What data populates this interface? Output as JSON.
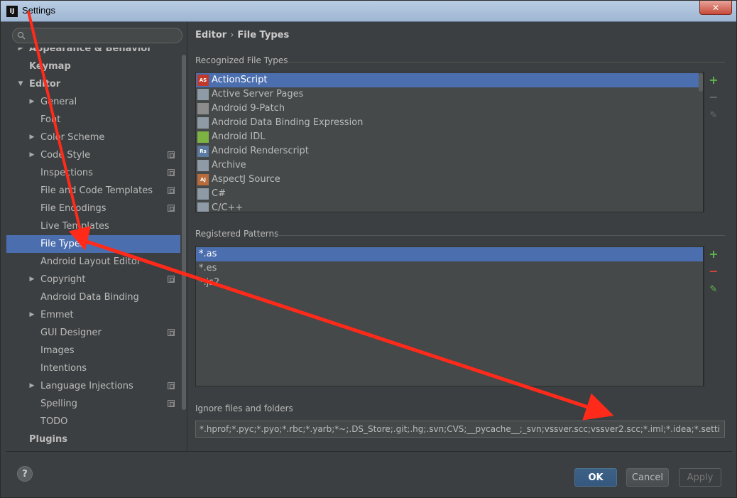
{
  "window": {
    "title": "Settings",
    "app_icon_text": "IJ",
    "close_glyph": "✕"
  },
  "search": {
    "placeholder": "",
    "value": ""
  },
  "tree": [
    {
      "label": "Appearance & Behavior",
      "level": 0,
      "arrow": "▶",
      "bold": true
    },
    {
      "label": "Keymap",
      "level": 0,
      "arrow": "",
      "bold": true
    },
    {
      "label": "Editor",
      "level": 0,
      "arrow": "▼",
      "bold": true
    },
    {
      "label": "General",
      "level": 1,
      "arrow": "▶"
    },
    {
      "label": "Font",
      "level": 1,
      "arrow": ""
    },
    {
      "label": "Color Scheme",
      "level": 1,
      "arrow": "▶"
    },
    {
      "label": "Code Style",
      "level": 1,
      "arrow": "▶",
      "project": true
    },
    {
      "label": "Inspections",
      "level": 1,
      "arrow": "",
      "project": true
    },
    {
      "label": "File and Code Templates",
      "level": 1,
      "arrow": "",
      "project": true
    },
    {
      "label": "File Encodings",
      "level": 1,
      "arrow": "",
      "project": true
    },
    {
      "label": "Live Templates",
      "level": 1,
      "arrow": ""
    },
    {
      "label": "File Types",
      "level": 1,
      "arrow": "",
      "selected": true
    },
    {
      "label": "Android Layout Editor",
      "level": 1,
      "arrow": ""
    },
    {
      "label": "Copyright",
      "level": 1,
      "arrow": "▶",
      "project": true
    },
    {
      "label": "Android Data Binding",
      "level": 1,
      "arrow": ""
    },
    {
      "label": "Emmet",
      "level": 1,
      "arrow": "▶"
    },
    {
      "label": "GUI Designer",
      "level": 1,
      "arrow": "",
      "project": true
    },
    {
      "label": "Images",
      "level": 1,
      "arrow": ""
    },
    {
      "label": "Intentions",
      "level": 1,
      "arrow": ""
    },
    {
      "label": "Language Injections",
      "level": 1,
      "arrow": "▶",
      "project": true
    },
    {
      "label": "Spelling",
      "level": 1,
      "arrow": "",
      "project": true
    },
    {
      "label": "TODO",
      "level": 1,
      "arrow": ""
    },
    {
      "label": "Plugins",
      "level": 0,
      "arrow": "",
      "bold": true
    }
  ],
  "breadcrumb": {
    "parent": "Editor",
    "separator": "›",
    "current": "File Types"
  },
  "recognized": {
    "label": "Recognized File Types",
    "items": [
      {
        "name": "ActionScript",
        "icon": "actionscript-icon",
        "icon_text": "AS",
        "color": "#c0392b",
        "selected": true
      },
      {
        "name": "Active Server Pages",
        "icon": "file-person-icon",
        "icon_text": "",
        "color": "#8e9aa5"
      },
      {
        "name": "Android 9-Patch",
        "icon": "folder-icon",
        "icon_text": "",
        "color": "#8c8c8c"
      },
      {
        "name": "Android Data Binding Expression",
        "icon": "file-person-icon",
        "icon_text": "",
        "color": "#8e9aa5"
      },
      {
        "name": "Android IDL",
        "icon": "android-icon",
        "icon_text": "",
        "color": "#7cb342"
      },
      {
        "name": "Android Renderscript",
        "icon": "renderscript-icon",
        "icon_text": "Rs",
        "color": "#5d7aa0"
      },
      {
        "name": "Archive",
        "icon": "archive-icon",
        "icon_text": "",
        "color": "#8e9aa5"
      },
      {
        "name": "AspectJ Source",
        "icon": "aspectj-icon",
        "icon_text": "AJ",
        "color": "#b86b3d"
      },
      {
        "name": "C#",
        "icon": "file-person-icon",
        "icon_text": "",
        "color": "#8e9aa5"
      },
      {
        "name": "C/C++",
        "icon": "file-person-icon",
        "icon_text": "",
        "color": "#8e9aa5"
      }
    ]
  },
  "patterns": {
    "label": "Registered Patterns",
    "items": [
      {
        "name": "*.as",
        "selected": true
      },
      {
        "name": "*.es"
      },
      {
        "name": "*.js2"
      }
    ]
  },
  "tools": {
    "add": "+",
    "remove": "−",
    "edit": "✎"
  },
  "ignore": {
    "label": "Ignore files and folders",
    "value": "*.hprof;*.pyc;*.pyo;*.rbc;*.yarb;*~;.DS_Store;.git;.hg;.svn;CVS;__pycache__;_svn;vssver.scc;vssver2.scc;*.iml;*.idea;*.settings;out;"
  },
  "buttons": {
    "help": "?",
    "ok": "OK",
    "cancel": "Cancel",
    "apply": "Apply"
  },
  "colors": {
    "accent": "#4b6eaf",
    "annotation": "#ff2a1a",
    "add": "#5fb84a",
    "remove": "#d9463a"
  }
}
